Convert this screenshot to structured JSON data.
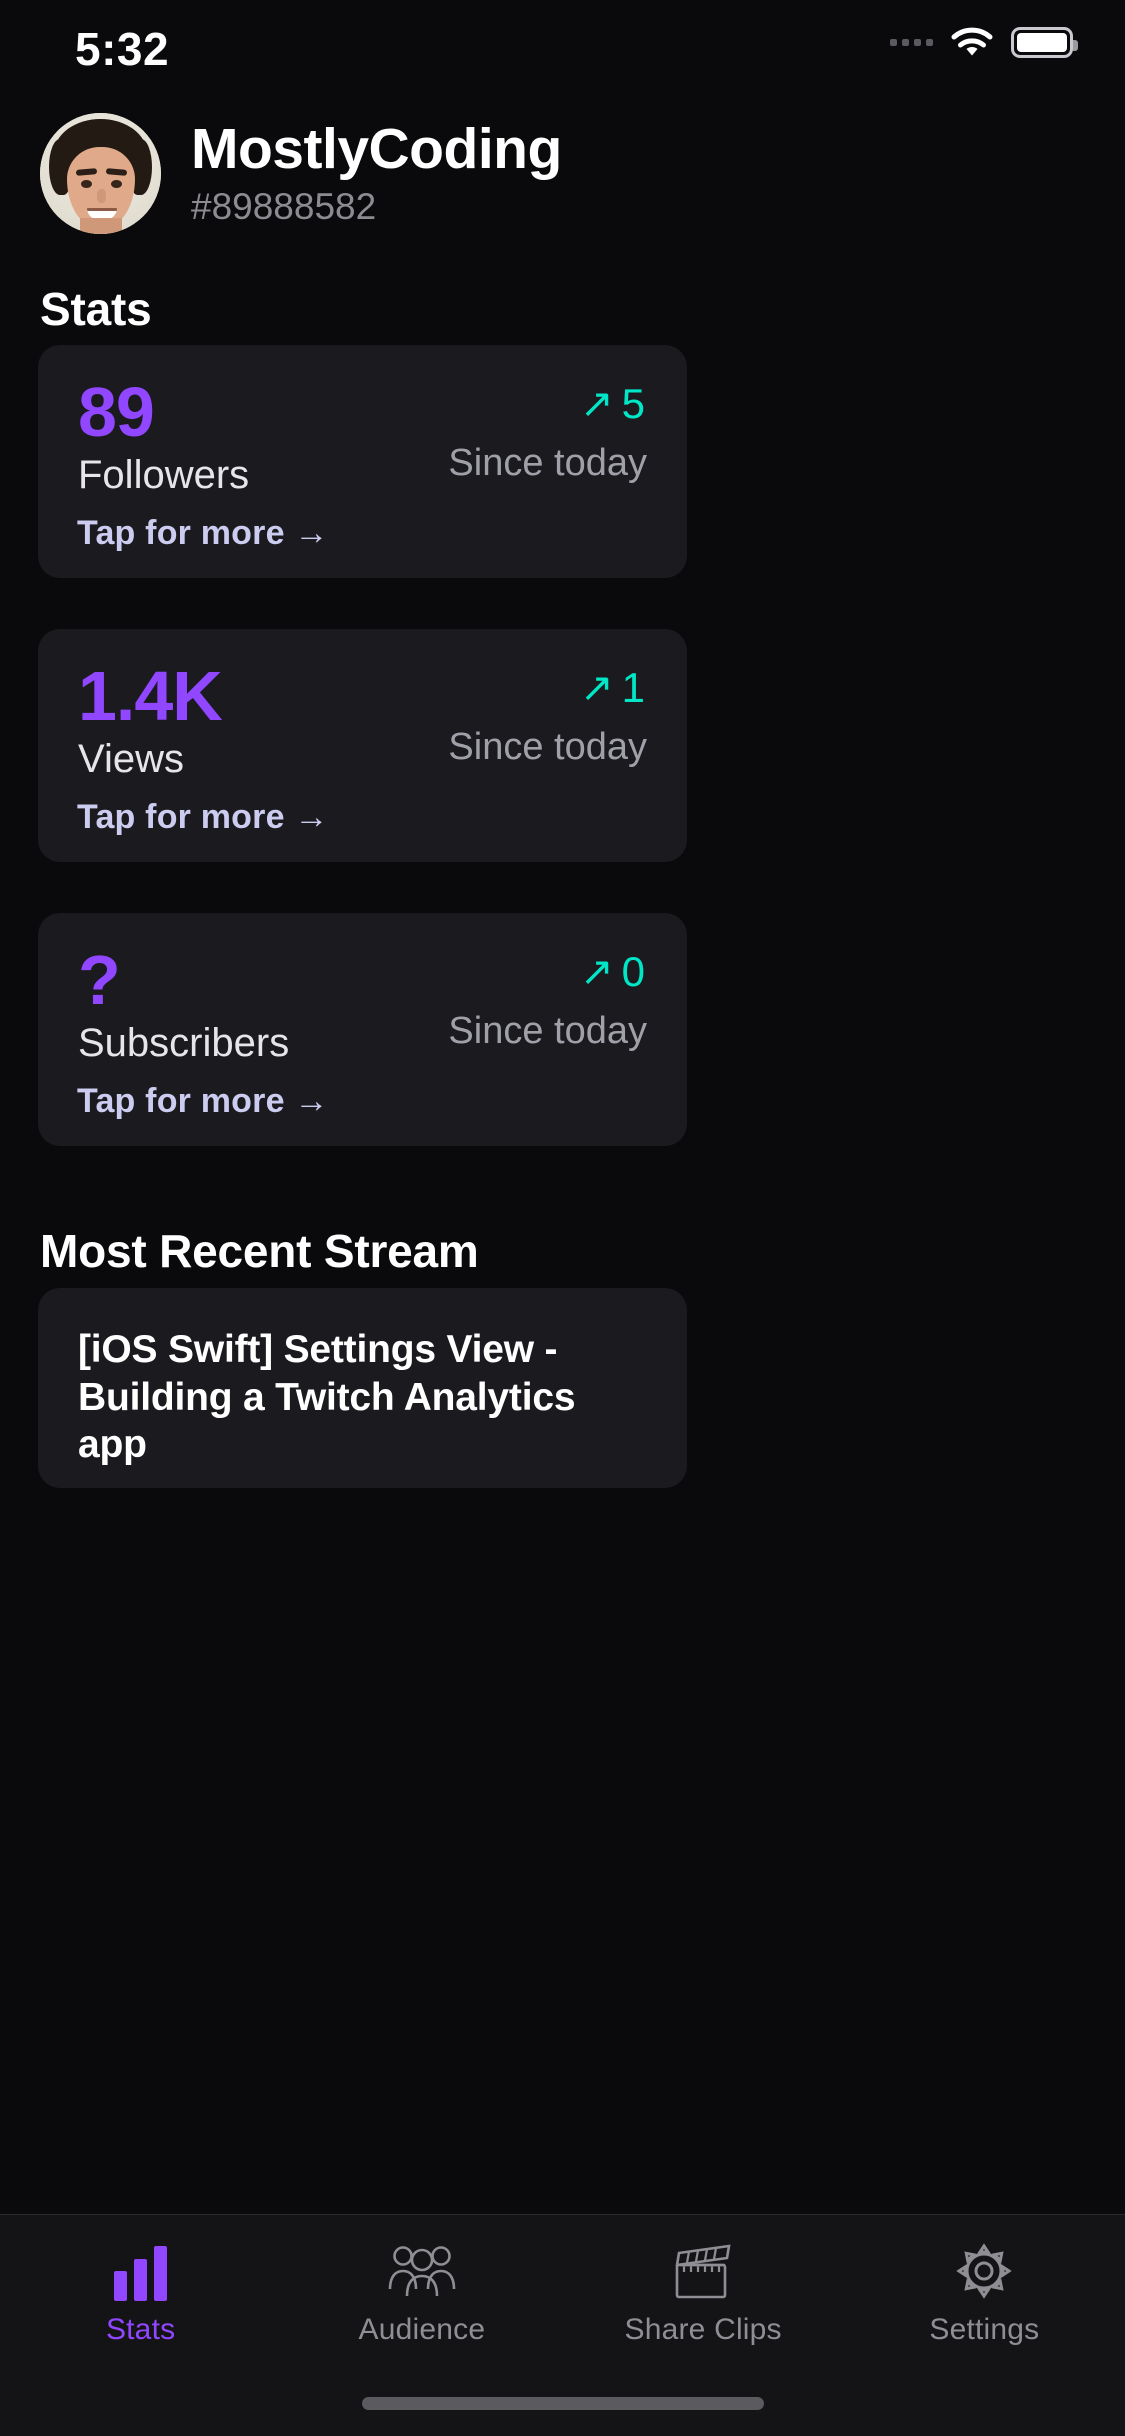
{
  "status_bar": {
    "time": "5:32",
    "icons": [
      "signal-dots-icon",
      "wifi-icon",
      "battery-icon"
    ]
  },
  "profile": {
    "avatar": "user-avatar-photo",
    "display_name": "MostlyCoding",
    "user_id": "#89888582"
  },
  "sections": {
    "stats_heading": "Stats",
    "recent_stream_heading": "Most Recent Stream"
  },
  "stats_cards": [
    {
      "value": "89",
      "label": "Followers",
      "more_label": "Tap for more →",
      "delta_arrow": "↗",
      "delta_value": "5",
      "delta_period": "Since today"
    },
    {
      "value": "1.4K",
      "label": "Views",
      "more_label": "Tap for more →",
      "delta_arrow": "↗",
      "delta_value": "1",
      "delta_period": "Since today"
    },
    {
      "value": "?",
      "label": "Subscribers",
      "more_label": "Tap for more →",
      "delta_arrow": "↗",
      "delta_value": "0",
      "delta_period": "Since today"
    }
  ],
  "recent_stream": {
    "title": "[iOS Swift] Settings View - Building a Twitch Analytics app"
  },
  "tab_bar": {
    "items": [
      {
        "label": "Stats",
        "icon": "bar-chart-icon",
        "active": true
      },
      {
        "label": "Audience",
        "icon": "people-group-icon",
        "active": false
      },
      {
        "label": "Share Clips",
        "icon": "clapperboard-icon",
        "active": false
      },
      {
        "label": "Settings",
        "icon": "gear-icon",
        "active": false
      }
    ]
  },
  "colors": {
    "background": "#0a0a0c",
    "card": "#1a1a1f",
    "accent_purple": "#9146ff",
    "accent_teal": "#00e7c8",
    "muted_text": "#8b8b91",
    "link_lavender": "#ccccf0"
  }
}
